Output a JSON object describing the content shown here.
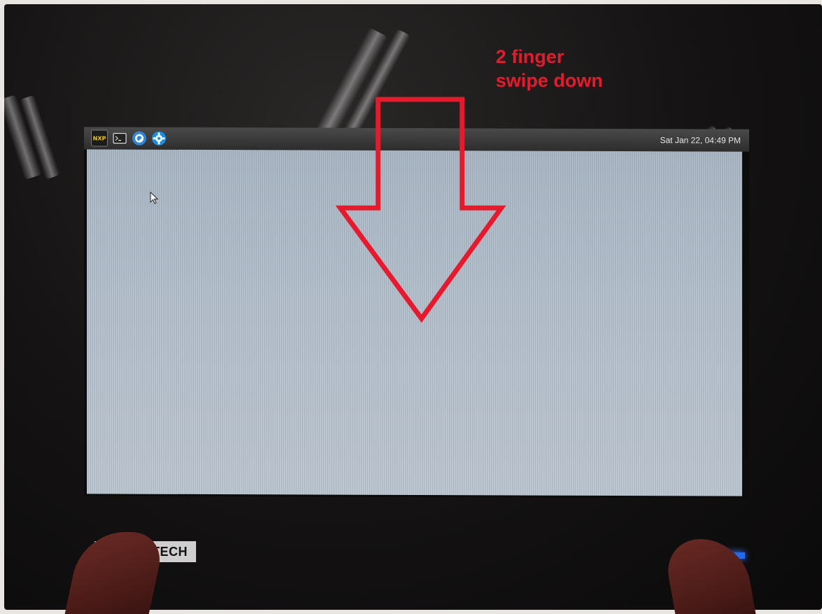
{
  "panel": {
    "icons": [
      "nxp-logo-icon",
      "terminal-icon",
      "browser-icon",
      "settings-gear-icon"
    ],
    "nxp_label": "NXP",
    "clock": "Sat Jan 22, 04:49 PM"
  },
  "bezel": {
    "brand_text": "AD  TECH"
  },
  "annotation": {
    "line1": "2 finger",
    "line2": "swipe down",
    "color": "#e8192c"
  },
  "colors": {
    "desktop": "#b3bfcc",
    "panel": "#3a3a3a",
    "led": "#1e6bff"
  }
}
